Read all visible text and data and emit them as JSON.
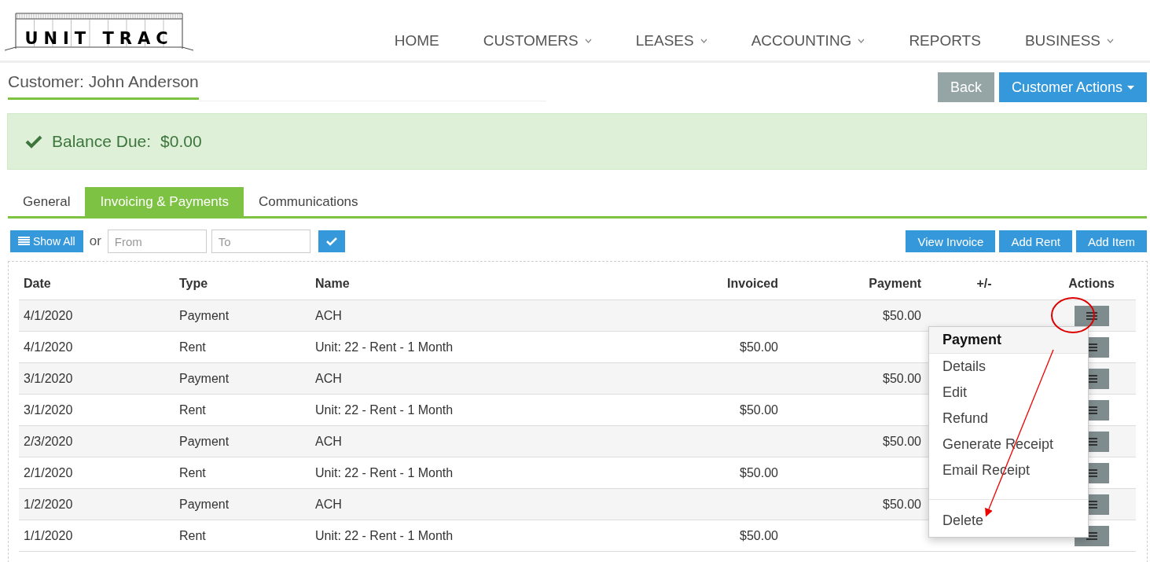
{
  "logo": "UNIT TRAC",
  "nav": [
    {
      "label": "HOME",
      "dropdown": false
    },
    {
      "label": "CUSTOMERS",
      "dropdown": true
    },
    {
      "label": "LEASES",
      "dropdown": true
    },
    {
      "label": "ACCOUNTING",
      "dropdown": true
    },
    {
      "label": "REPORTS",
      "dropdown": false
    },
    {
      "label": "BUSINESS",
      "dropdown": true
    }
  ],
  "page_title": "Customer: John Anderson",
  "header_buttons": [
    {
      "label": "Back",
      "kind": "secondary"
    },
    {
      "label": "Customer Actions",
      "kind": "primary-dropdown"
    }
  ],
  "alert": {
    "label": "Balance Due:",
    "value": "$0.00"
  },
  "tabs": [
    {
      "label": "General",
      "selected": false
    },
    {
      "label": "Invoicing & Payments",
      "selected": true
    },
    {
      "label": "Communications",
      "selected": false
    }
  ],
  "filter": {
    "show_all": "Show All",
    "or": "or",
    "from_placeholder": "From",
    "to_placeholder": "To"
  },
  "toolbar_buttons": [
    "View Invoice",
    "Add Rent",
    "Add Item"
  ],
  "table": {
    "columns": [
      "Date",
      "Type",
      "Name",
      "Invoiced",
      "Payment",
      "+/-",
      "Actions"
    ],
    "rows": [
      {
        "date": "4/1/2020",
        "type": "Payment",
        "name": "ACH",
        "invoiced": "",
        "payment": "$50.00"
      },
      {
        "date": "4/1/2020",
        "type": "Rent",
        "name": "Unit: 22 - Rent - 1 Month",
        "invoiced": "$50.00",
        "payment": ""
      },
      {
        "date": "3/1/2020",
        "type": "Payment",
        "name": "ACH",
        "invoiced": "",
        "payment": "$50.00"
      },
      {
        "date": "3/1/2020",
        "type": "Rent",
        "name": "Unit: 22 - Rent - 1 Month",
        "invoiced": "$50.00",
        "payment": ""
      },
      {
        "date": "2/3/2020",
        "type": "Payment",
        "name": "ACH",
        "invoiced": "",
        "payment": "$50.00"
      },
      {
        "date": "2/1/2020",
        "type": "Rent",
        "name": "Unit: 22 - Rent - 1 Month",
        "invoiced": "$50.00",
        "payment": ""
      },
      {
        "date": "1/2/2020",
        "type": "Payment",
        "name": "ACH",
        "invoiced": "",
        "payment": "$50.00"
      },
      {
        "date": "1/1/2020",
        "type": "Rent",
        "name": "Unit: 22 - Rent - 1 Month",
        "invoiced": "$50.00",
        "payment": ""
      }
    ]
  },
  "action_menu": {
    "header": "Payment",
    "items": [
      {
        "label": "Details",
        "kind": "item"
      },
      {
        "label": "Edit",
        "kind": "item"
      },
      {
        "label": "Refund",
        "kind": "item"
      },
      {
        "label": "Generate Receipt",
        "kind": "item"
      },
      {
        "label": "Email Receipt",
        "kind": "item"
      },
      {
        "kind": "divider"
      },
      {
        "label": "Delete",
        "kind": "item"
      }
    ]
  }
}
